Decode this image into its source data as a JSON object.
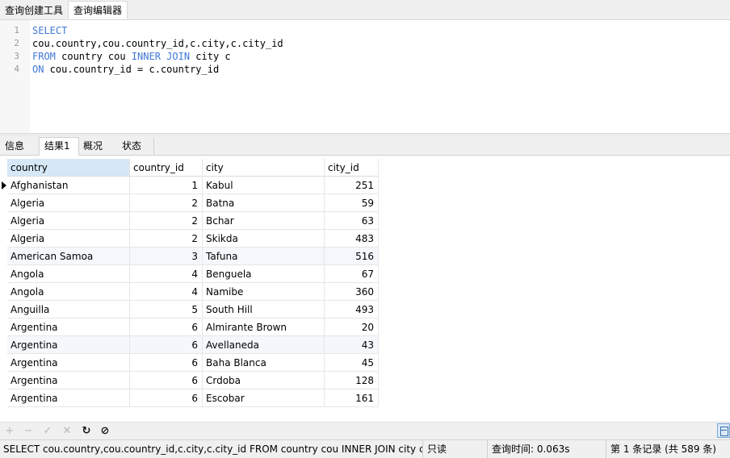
{
  "top_tabs": [
    "查询创建工具",
    "查询编辑器"
  ],
  "editor": {
    "lines": [
      {
        "num": "1",
        "parts": [
          {
            "t": "SELECT",
            "k": true
          }
        ]
      },
      {
        "num": "2",
        "parts": [
          {
            "t": "cou.country,cou.country_id,c.city,c.city_id",
            "k": false
          }
        ]
      },
      {
        "num": "3",
        "parts": [
          {
            "t": "FROM",
            "k": true
          },
          {
            "t": " country cou ",
            "k": false
          },
          {
            "t": "INNER JOIN",
            "k": true
          },
          {
            "t": " city c",
            "k": false
          }
        ]
      },
      {
        "num": "4",
        "parts": [
          {
            "t": "ON",
            "k": true
          },
          {
            "t": " cou.country_id = c.country_id",
            "k": false
          }
        ]
      }
    ]
  },
  "result_tabs": [
    "信息",
    "结果1",
    "概况",
    "状态"
  ],
  "grid": {
    "columns": [
      "country",
      "country_id",
      "city",
      "city_id"
    ],
    "rows": [
      [
        "Afghanistan",
        "1",
        "Kabul",
        "251"
      ],
      [
        "Algeria",
        "2",
        "Batna",
        "59"
      ],
      [
        "Algeria",
        "2",
        "Bchar",
        "63"
      ],
      [
        "Algeria",
        "2",
        "Skikda",
        "483"
      ],
      [
        "American Samoa",
        "3",
        "Tafuna",
        "516"
      ],
      [
        "Angola",
        "4",
        "Benguela",
        "67"
      ],
      [
        "Angola",
        "4",
        "Namibe",
        "360"
      ],
      [
        "Anguilla",
        "5",
        "South Hill",
        "493"
      ],
      [
        "Argentina",
        "6",
        "Almirante Brown",
        "20"
      ],
      [
        "Argentina",
        "6",
        "Avellaneda",
        "43"
      ],
      [
        "Argentina",
        "6",
        "Baha Blanca",
        "45"
      ],
      [
        "Argentina",
        "6",
        "Crdoba",
        "128"
      ],
      [
        "Argentina",
        "6",
        "Escobar",
        "161"
      ]
    ]
  },
  "nav_buttons": [
    {
      "name": "add-record-icon",
      "glyph": "+",
      "enabled": false
    },
    {
      "name": "delete-record-icon",
      "glyph": "−",
      "enabled": false
    },
    {
      "name": "apply-changes-icon",
      "glyph": "✓",
      "enabled": false
    },
    {
      "name": "discard-changes-icon",
      "glyph": "✕",
      "enabled": false
    },
    {
      "name": "refresh-icon",
      "glyph": "↻",
      "enabled": true
    },
    {
      "name": "stop-icon",
      "glyph": "⊘",
      "enabled": true
    }
  ],
  "status": {
    "sql": "SELECT  cou.country,cou.country_id,c.city,c.city_id FROM country cou INNER JOIN city c  ON cou.country_id = c.country_id",
    "mode": "只读",
    "query_time": "查询时间: 0.063s",
    "record": "第 1 条记录 (共 589 条)"
  },
  "colors": {
    "keyword": "#3f78d6",
    "selected_header": "#d6e8f7"
  }
}
